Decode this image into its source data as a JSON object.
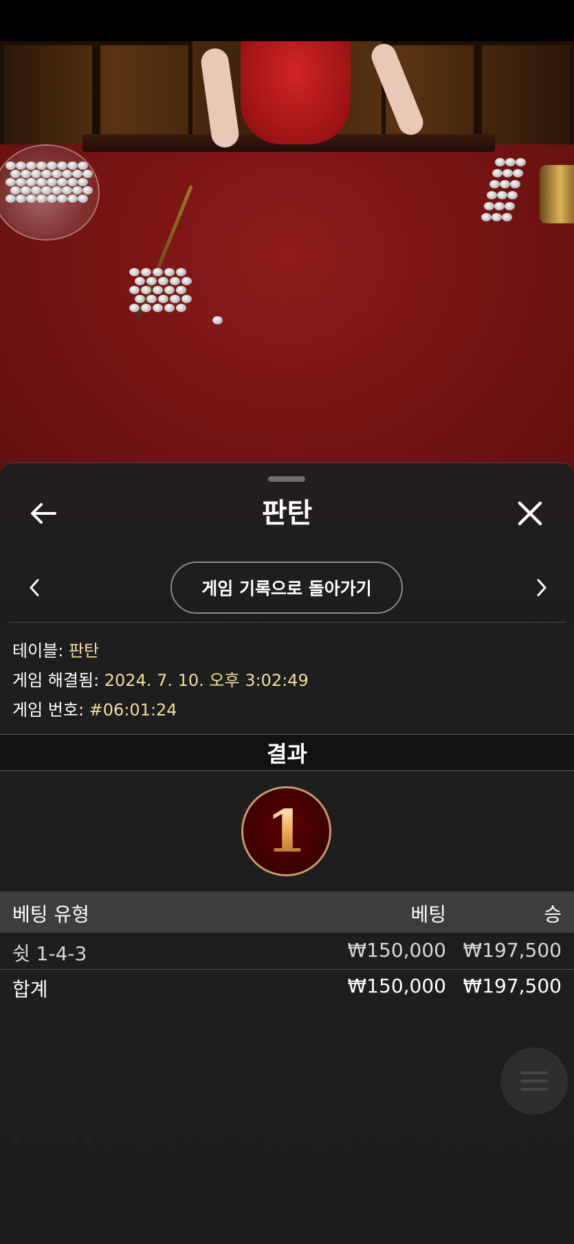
{
  "sheet": {
    "title": "판탄",
    "back_icon": "arrow-left-icon",
    "close_icon": "close-icon",
    "prev_icon": "chevron-left-icon",
    "next_icon": "chevron-right-icon",
    "history_button_label": "게임 기록으로 돌아가기"
  },
  "info": {
    "table_label": "테이블: ",
    "table_value": "판탄",
    "resolved_label": "게임 해결됨: ",
    "resolved_value": "2024. 7. 10. 오후 3:02:49",
    "game_no_label": "게임 번호: ",
    "game_no_value": "#06:01:24"
  },
  "result": {
    "heading": "결과",
    "number": "1"
  },
  "bets": {
    "columns": [
      "베팅 유형",
      "베팅",
      "승"
    ],
    "rows": [
      {
        "type": "쉿 1-4-3",
        "bet": "₩150,000",
        "win": "₩197,500"
      }
    ],
    "total": {
      "label": "합계",
      "bet": "₩150,000",
      "win": "₩197,500"
    }
  },
  "colors": {
    "accent_gold": "#f4dca0",
    "sheet_bg": "#1e1e1e",
    "result_ring": "#c69a6b",
    "result_fill": "#5a0000"
  }
}
